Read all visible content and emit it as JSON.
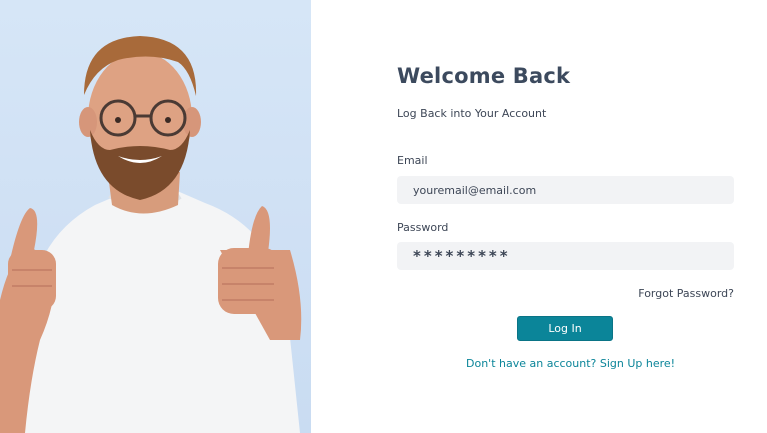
{
  "login": {
    "title": "Welcome Back",
    "subtitle": "Log Back into Your Account",
    "email_label": "Email",
    "email_value": "youremail@email.com",
    "password_label": "Password",
    "password_value": "*********",
    "forgot_link": "Forgot Password?",
    "login_button": "Log In",
    "signup_link": "Don't have an account? Sign Up here!"
  },
  "colors": {
    "accent": "#0b8599",
    "title_text": "#3c4a5e",
    "field_background": "#f2f3f5",
    "hero_background": "#d6e6f7"
  },
  "hero_image": {
    "subject": "smiling bearded man with glasses giving thumbs up"
  }
}
